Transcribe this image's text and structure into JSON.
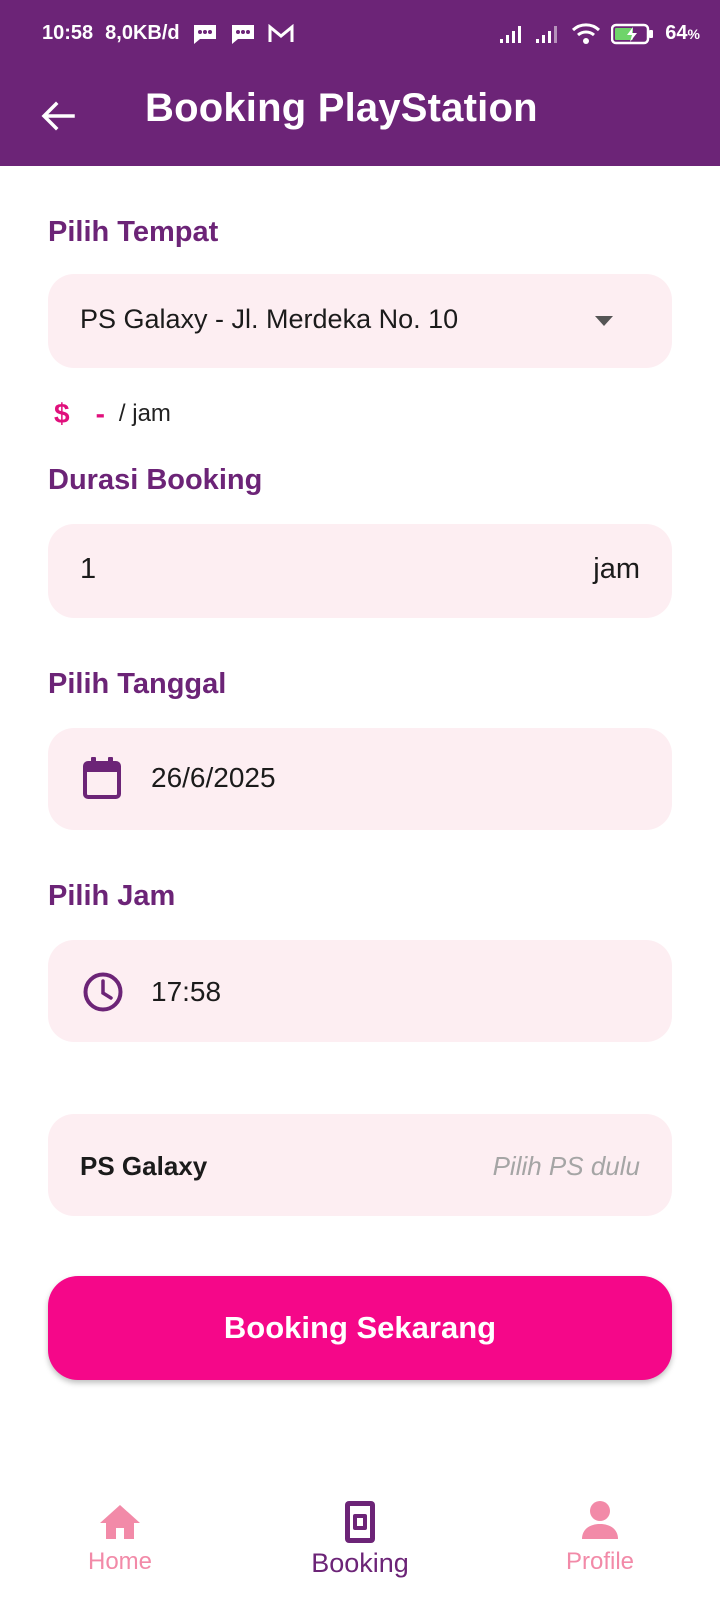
{
  "status_bar": {
    "time": "10:58",
    "net_speed": "8,0KB/d",
    "battery": "64",
    "battery_unit": "%"
  },
  "app_bar": {
    "title": "Booking PlayStation"
  },
  "form": {
    "place_label": "Pilih Tempat",
    "place_value": "PS Galaxy - Jl. Merdeka No. 10",
    "price_symbol": "$",
    "price_value": "-",
    "price_unit": "/ jam",
    "duration_label": "Durasi Booking",
    "duration_value": "1",
    "duration_suffix": "jam",
    "date_label": "Pilih Tanggal",
    "date_value": "26/6/2025",
    "time_label": "Pilih Jam",
    "time_value": "17:58",
    "ps_name": "PS Galaxy",
    "ps_hint": "Pilih PS dulu",
    "submit_label": "Booking Sekarang"
  },
  "bottom_nav": {
    "items": [
      {
        "label": "Home",
        "icon": "home-icon",
        "active": false
      },
      {
        "label": "Booking",
        "icon": "booking-icon",
        "active": true
      },
      {
        "label": "Profile",
        "icon": "person-icon",
        "active": false
      }
    ]
  },
  "colors": {
    "primary": "#6c2477",
    "accent": "#f50789",
    "field_bg": "#fdeef2",
    "nav_inactive": "#f28aa8"
  }
}
